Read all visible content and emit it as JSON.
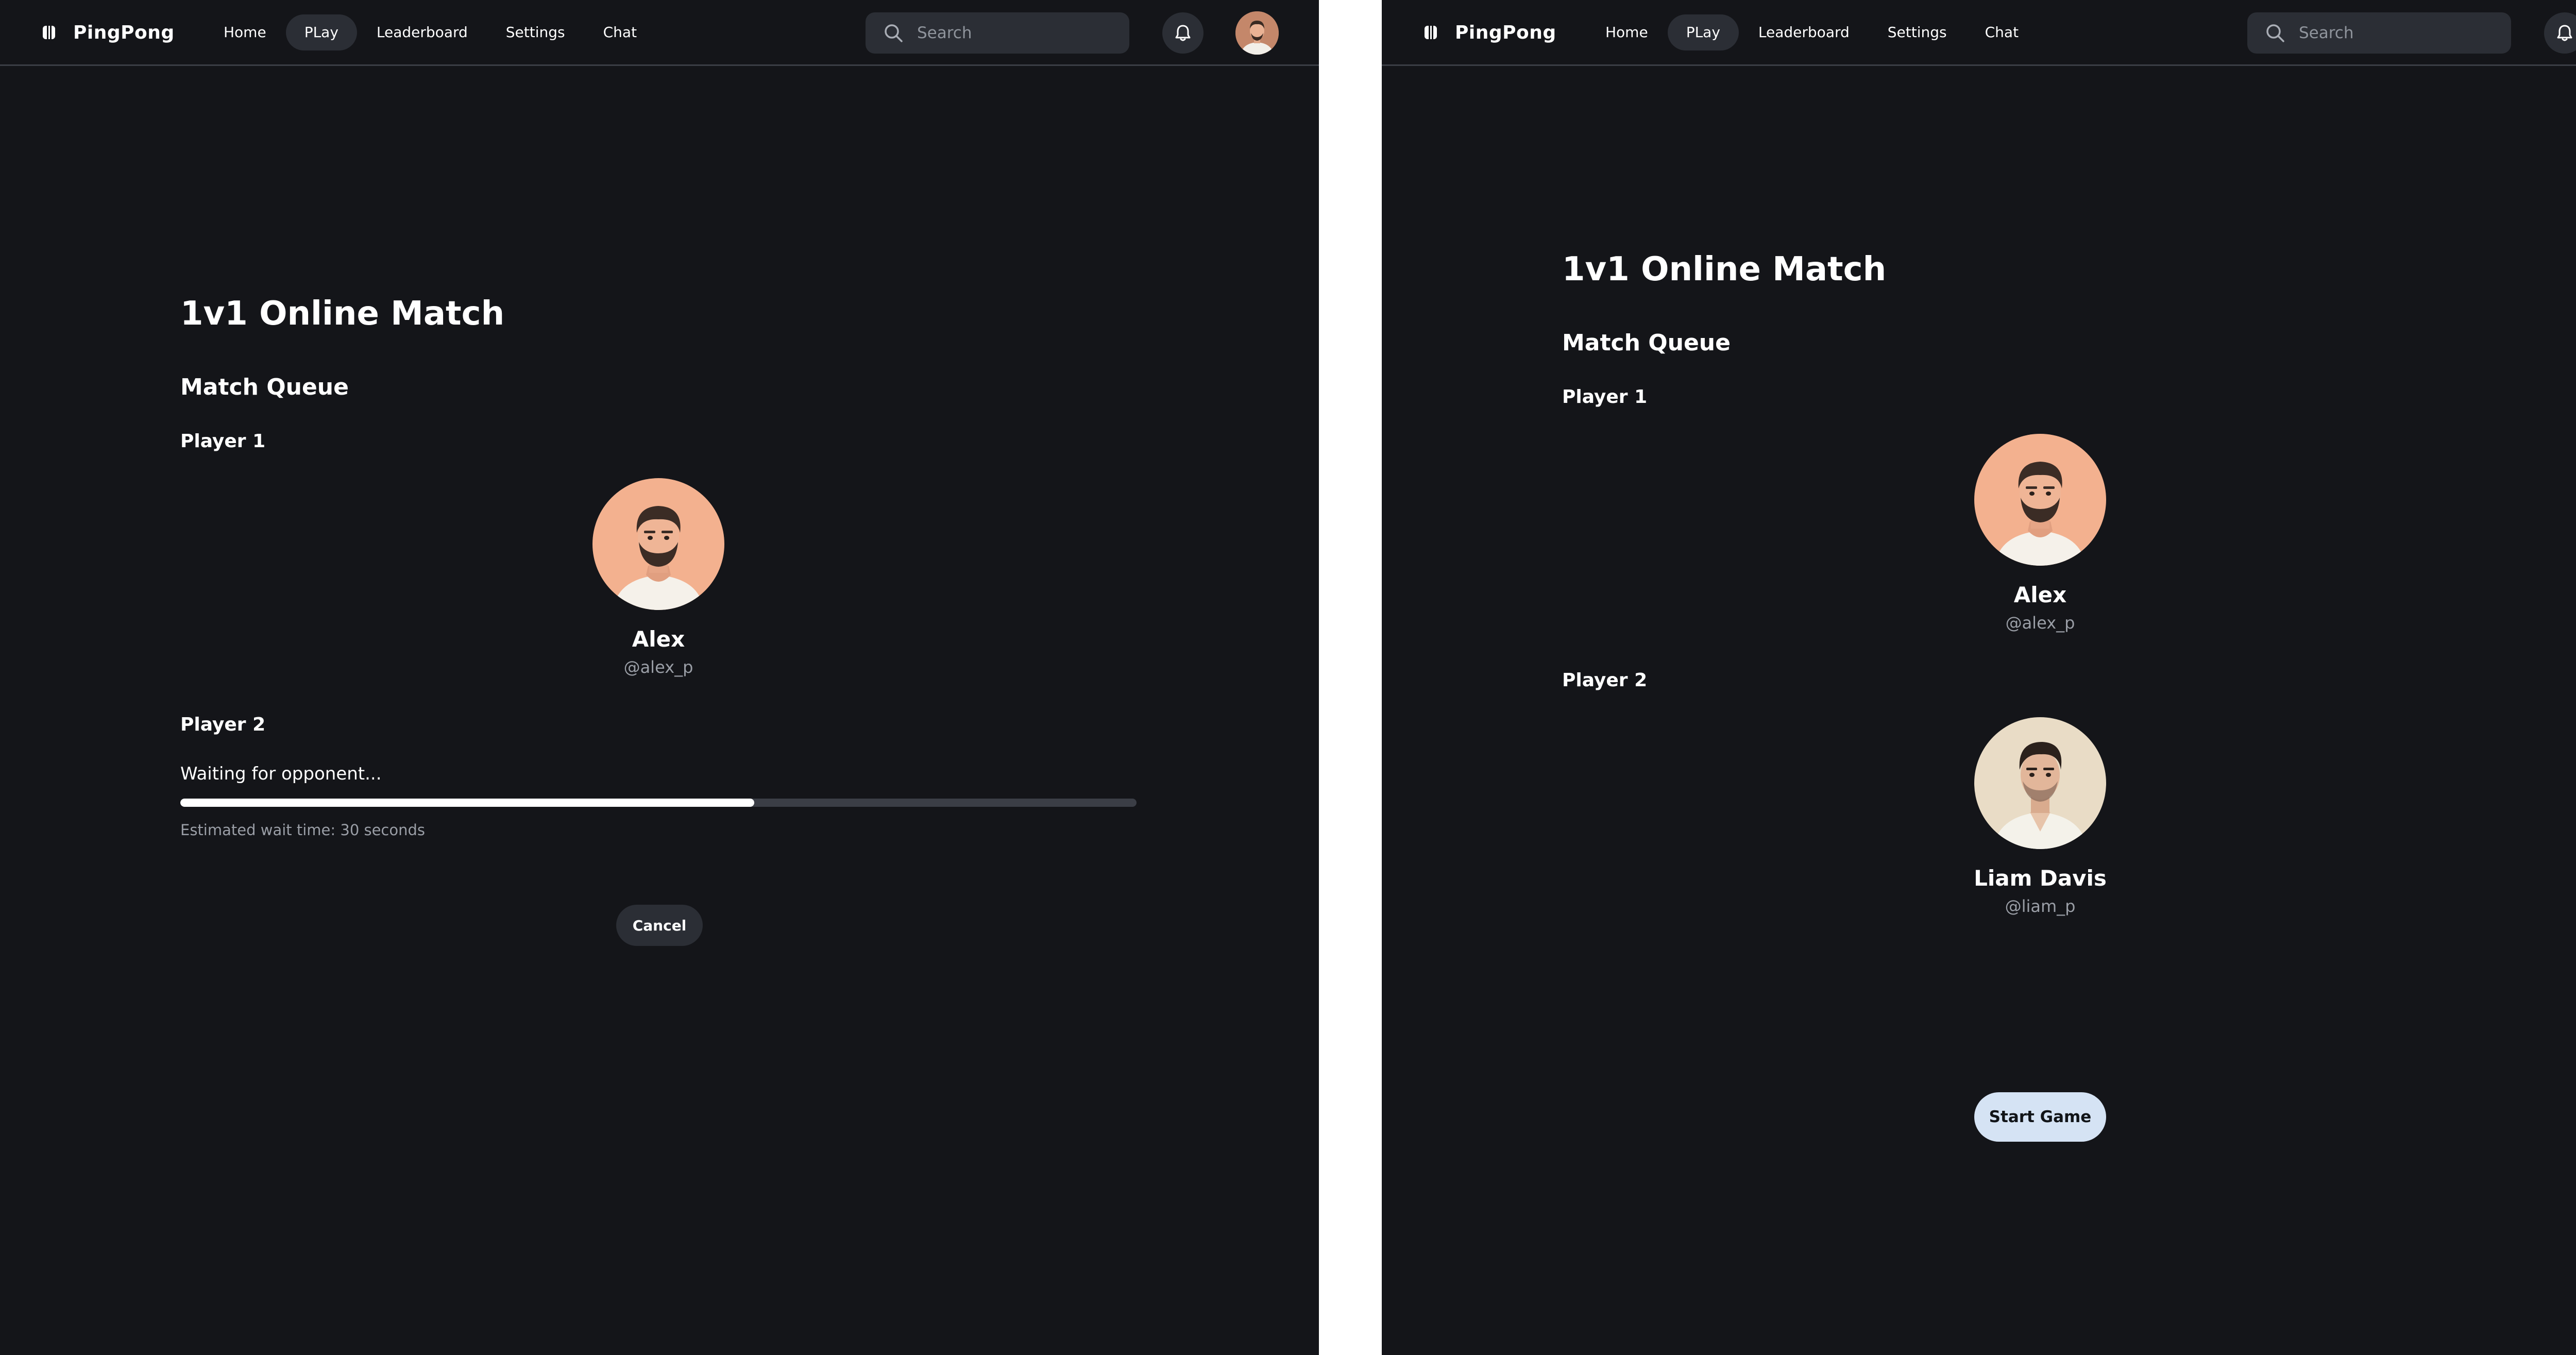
{
  "colors": {
    "background": "#141519",
    "surface": "#2b2e35",
    "text": "#ffffff",
    "muted": "#9a9ea6",
    "primary_button": "#d5e3f4",
    "progress_fill": "#ffffff",
    "progress_track": "#3b3e46"
  },
  "header": {
    "brand": {
      "icon": "paddle-logo-icon",
      "name": "PingPong"
    },
    "nav": [
      {
        "label": "Home",
        "active": false
      },
      {
        "label": "PLay",
        "active": true
      },
      {
        "label": "Leaderboard",
        "active": false
      },
      {
        "label": "Settings",
        "active": false
      },
      {
        "label": "Chat",
        "active": false
      }
    ],
    "search": {
      "placeholder": "Search",
      "value": "",
      "icon": "search-icon"
    },
    "notifications_icon": "bell-icon",
    "profile_avatar": "user-avatar"
  },
  "screens": {
    "waiting": {
      "title": "1v1 Online Match",
      "queue_heading": "Match Queue",
      "player1": {
        "label": "Player 1",
        "name": "Alex",
        "handle": "@alex_p"
      },
      "player2": {
        "label": "Player 2",
        "status": "Waiting for opponent...",
        "progress": 0.6,
        "estimated_wait": "Estimated wait time: 30 seconds"
      },
      "cancel_label": "Cancel"
    },
    "matched": {
      "title": "1v1 Online Match",
      "queue_heading": "Match Queue",
      "player1": {
        "label": "Player 1",
        "name": "Alex",
        "handle": "@alex_p"
      },
      "player2": {
        "label": "Player 2",
        "name": "Liam Davis",
        "handle": "@liam_p"
      },
      "start_label": "Start Game"
    }
  }
}
